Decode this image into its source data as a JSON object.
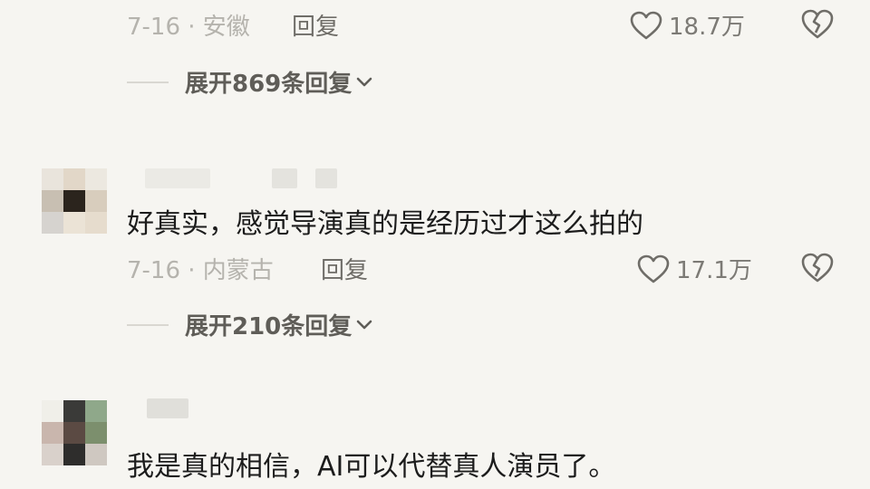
{
  "comments": [
    {
      "date_location": "7-16 · 安徽",
      "reply_label": "回复",
      "like_count": "18.7万",
      "expand_label": "展开869条回复"
    },
    {
      "text": "好真实，感觉导演真的是经历过才这么拍的",
      "date_location": "7-16 · 内蒙古",
      "reply_label": "回复",
      "like_count": "17.1万",
      "expand_label": "展开210条回复"
    },
    {
      "text": "我是真的相信，AI可以代替真人演员了。"
    }
  ],
  "icons": {
    "like": "heart-outline-icon",
    "dislike": "broken-heart-icon",
    "expand": "chevron-down-icon"
  },
  "colors": {
    "background": "#f6f5f1",
    "meta_text": "#b5b3ad",
    "reply_text": "#6f6d68",
    "body_text": "#1c1c1c"
  }
}
